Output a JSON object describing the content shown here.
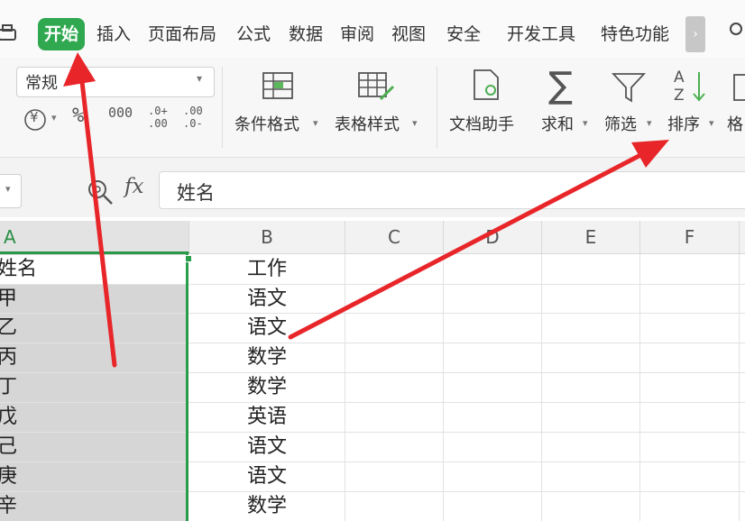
{
  "menu": {
    "tabs": [
      "开始",
      "插入",
      "页面布局",
      "公式",
      "数据",
      "审阅",
      "视图",
      "安全",
      "开发工具",
      "特色功能"
    ],
    "active_tab": "开始",
    "more": "›"
  },
  "ribbon": {
    "number_format": "常规",
    "currency": "¥",
    "percent": "%",
    "thousands": "000",
    "inc_decimal": ".0+ .00",
    "dec_decimal": ".00 .0-",
    "conditional_format": "条件格式",
    "table_style": "表格样式",
    "doc_helper": "文档助手",
    "sum": "求和",
    "filter": "筛选",
    "sort": "排序",
    "cut_off": "格"
  },
  "formula_bar": {
    "fx": "fx",
    "content": "姓名"
  },
  "grid": {
    "columns": [
      "A",
      "B",
      "C",
      "D",
      "E",
      "F"
    ],
    "rows": [
      {
        "a": "姓名",
        "b": "工作"
      },
      {
        "a": "甲",
        "b": "语文"
      },
      {
        "a": "乙",
        "b": "语文"
      },
      {
        "a": "丙",
        "b": "数学"
      },
      {
        "a": "丁",
        "b": "数学"
      },
      {
        "a": "戊",
        "b": "英语"
      },
      {
        "a": "己",
        "b": "语文"
      },
      {
        "a": "庚",
        "b": "语文"
      },
      {
        "a": "辛",
        "b": "数学"
      }
    ]
  },
  "colors": {
    "accent": "#2fa84f",
    "annotation": "#e8262a"
  }
}
